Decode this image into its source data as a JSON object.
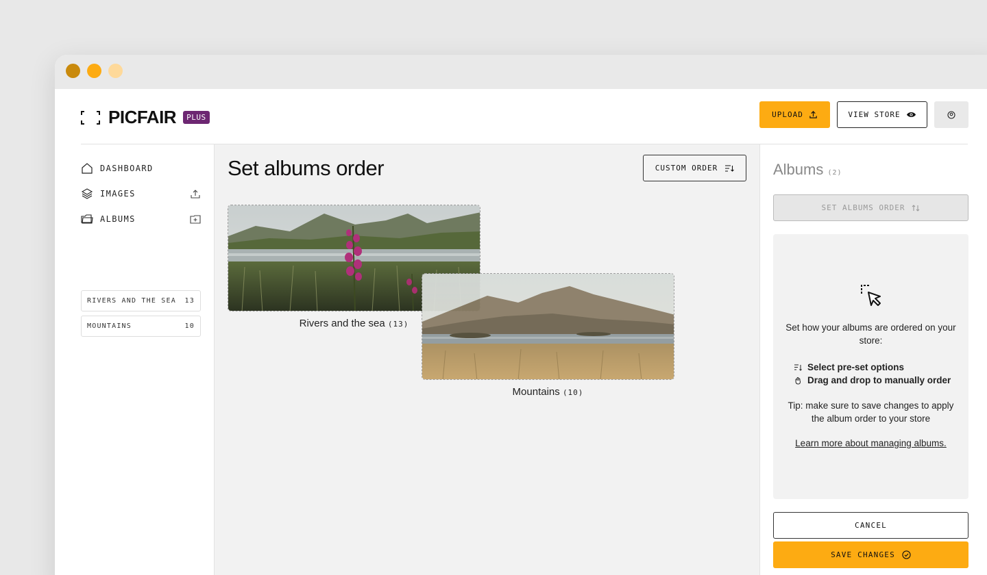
{
  "window": {
    "dots": [
      "#c98a0d",
      "#fdab12",
      "#fed99a"
    ]
  },
  "header": {
    "logo_text": "PICFAIR",
    "plus_badge": "PLUS",
    "upload_label": "UPLOAD",
    "view_store_label": "VIEW STORE",
    "account_icon": "user-icon"
  },
  "sidebar": {
    "nav": [
      {
        "label": "DASHBOARD",
        "icon": "home-icon"
      },
      {
        "label": "IMAGES",
        "icon": "layers-icon",
        "action_icon": "upload-icon"
      },
      {
        "label": "ALBUMS",
        "icon": "folder-icon",
        "action_icon": "add-folder-icon"
      }
    ],
    "albums": [
      {
        "name": "RIVERS AND THE SEA",
        "count": "13"
      },
      {
        "name": "MOUNTAINS",
        "count": "10"
      }
    ]
  },
  "main": {
    "title": "Set albums order",
    "custom_order_label": "CUSTOM ORDER",
    "cards": [
      {
        "name": "Rivers and the sea",
        "count": "(13)"
      },
      {
        "name": "Mountains",
        "count": "(10)"
      }
    ]
  },
  "right_panel": {
    "title": "Albums",
    "count": "(2)",
    "set_order_label": "SET ALBUMS ORDER",
    "intro": "Set how your albums are ordered on your store:",
    "options": [
      "Select pre-set options",
      "Drag and drop to manually order"
    ],
    "tip": "Tip: make sure to save changes to apply the album order to your store",
    "learn_more": "Learn more about managing albums.",
    "cancel_label": "CANCEL",
    "save_label": "SAVE CHANGES"
  },
  "colors": {
    "accent": "#fdab12",
    "plus_badge": "#6d2772"
  }
}
